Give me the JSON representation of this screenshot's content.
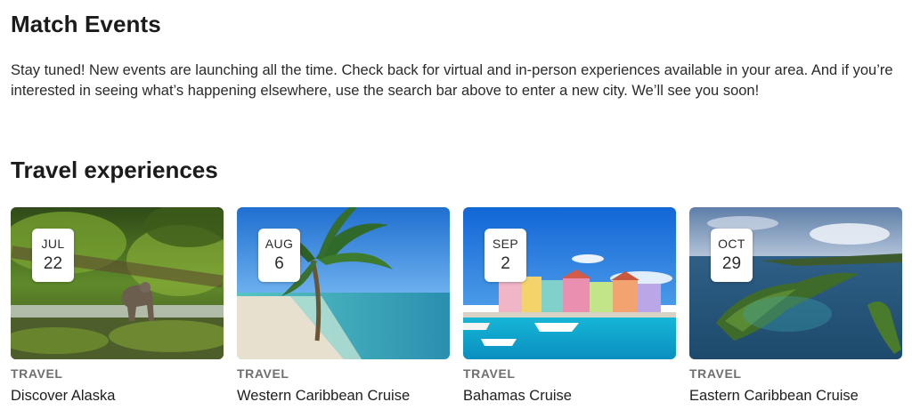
{
  "match_events": {
    "heading": "Match Events",
    "intro": "Stay tuned! New events are launching all the time. Check back for virtual and in-person experiences available in your area. And if you’re interested in seeing what’s happening elsewhere, use the search bar above to enter a new city. We’ll see you soon!"
  },
  "travel": {
    "heading": "Travel experiences",
    "cards": [
      {
        "month": "JUL",
        "day": "22",
        "category": "TRAVEL",
        "title": "Discover Alaska",
        "image": "bear-in-forest-stream"
      },
      {
        "month": "AUG",
        "day": "6",
        "category": "TRAVEL",
        "title": "Western Caribbean Cruise",
        "image": "palm-beach"
      },
      {
        "month": "SEP",
        "day": "2",
        "category": "TRAVEL",
        "title": "Bahamas Cruise",
        "image": "colorful-harbor"
      },
      {
        "month": "OCT",
        "day": "29",
        "category": "TRAVEL",
        "title": "Eastern Caribbean Cruise",
        "image": "island-aerial"
      }
    ]
  }
}
